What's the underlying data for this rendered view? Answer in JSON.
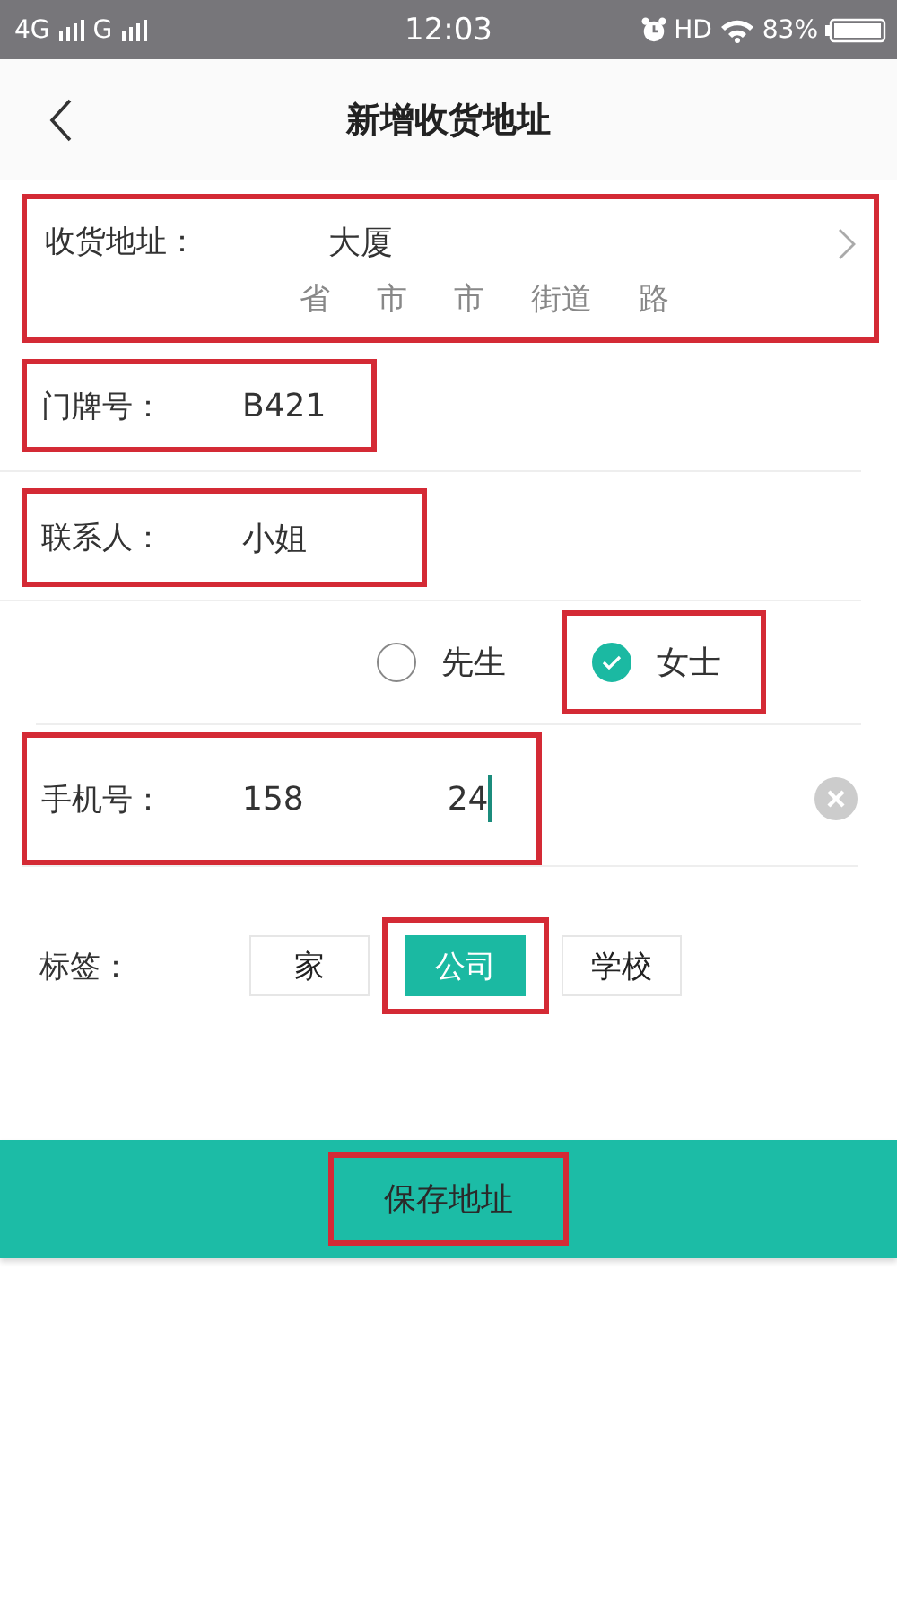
{
  "status_bar": {
    "network": "4G",
    "network_2": "G",
    "time": "12:03",
    "hd": "HD",
    "battery": "83%"
  },
  "nav": {
    "title": "新增收货地址"
  },
  "address": {
    "label": "收货地址：",
    "line_1": "大厦",
    "line_2_parts": [
      "省",
      "市",
      "市",
      "街道",
      "路"
    ],
    "highlighted": true
  },
  "fields": [
    {
      "label": "门牌号：",
      "value": "B421",
      "highlighted": true
    },
    {
      "label": "联系人：",
      "value": "小姐",
      "highlighted": true
    }
  ],
  "gender": [
    {
      "label": "先生",
      "selected": false,
      "highlighted": false
    },
    {
      "label": "女士",
      "selected": true,
      "highlighted": true
    }
  ],
  "phone": {
    "label": "手机号：",
    "value_parts": [
      "158",
      "24"
    ],
    "highlighted": true
  },
  "tags": {
    "label": "标签：",
    "items": [
      {
        "label": "家",
        "selected": false,
        "highlighted": false
      },
      {
        "label": "公司",
        "selected": true,
        "highlighted": true
      },
      {
        "label": "学校",
        "selected": false,
        "highlighted": false
      }
    ]
  },
  "save_button": {
    "label": "保存地址",
    "highlighted": true
  }
}
